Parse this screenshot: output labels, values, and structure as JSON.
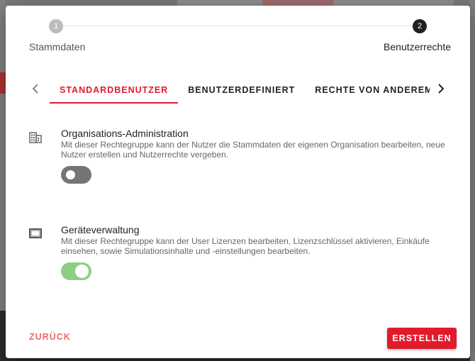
{
  "stepper": {
    "steps": [
      {
        "number": "1",
        "label": "Stammdaten"
      },
      {
        "number": "2",
        "label": "Benutzerrechte"
      }
    ]
  },
  "tabs": {
    "items": [
      {
        "label": "STANDARDBENUTZER"
      },
      {
        "label": "BENUTZERDEFINIERT"
      },
      {
        "label": "RECHTE VON ANDEREM BENUTZER"
      }
    ],
    "active_index": 0
  },
  "permissions": [
    {
      "icon": "building-icon",
      "title": "Organisations-Administration",
      "description": "Mit dieser Rechtegruppe kann der Nutzer die Stammdaten der eigenen Organisation bearbeiten, neue Nutzer erstellen und Nutzerrechte vergeben.",
      "enabled": false
    },
    {
      "icon": "device-frame-icon",
      "title": "Geräteverwaltung",
      "description": "Mit dieser Rechtegruppe kann der User Lizenzen bearbeiten, Lizenzschlüssel aktivieren, Einkäufe einsehen, sowie Simulationsinhalte und -einstellungen bearbeiten.",
      "enabled": true
    }
  ],
  "footer": {
    "back_label": "ZURÜCK",
    "create_label": "ERSTELLEN"
  },
  "colors": {
    "accent": "#e21b2c",
    "toggle_on": "#8fcd86",
    "toggle_off": "#757575"
  }
}
